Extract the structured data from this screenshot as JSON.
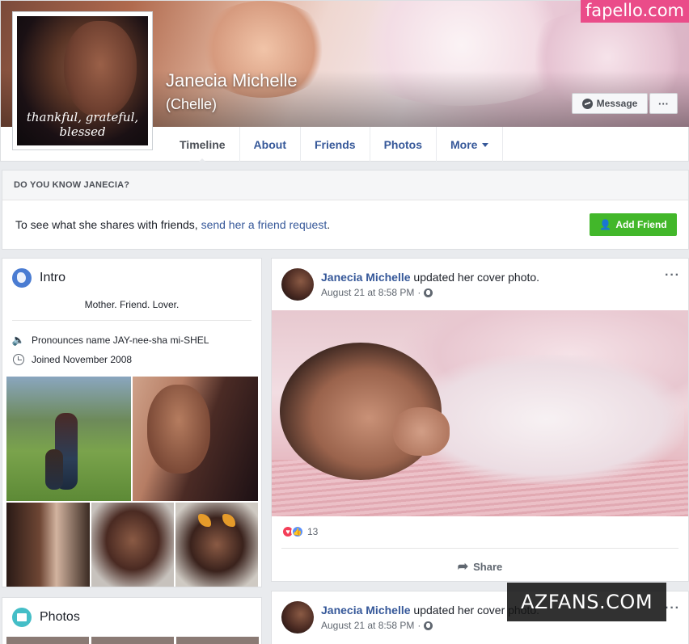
{
  "watermarks": {
    "top": "fapello.com",
    "bottom": "AZFANS.COM"
  },
  "profile": {
    "name": "Janecia Michelle",
    "nickname": "(Chelle)",
    "picture_caption": "thankful, grateful, blessed"
  },
  "actions": {
    "message_label": "Message",
    "more_label": "···"
  },
  "tabs": [
    {
      "label": "Timeline",
      "active": true
    },
    {
      "label": "About"
    },
    {
      "label": "Friends"
    },
    {
      "label": "Photos"
    },
    {
      "label": "More"
    }
  ],
  "know": {
    "heading": "DO YOU KNOW JANECIA?",
    "text_before": "To see what she shares with friends, ",
    "link": "send her a friend request",
    "text_after": ".",
    "add_friend_label": "Add Friend"
  },
  "intro": {
    "title": "Intro",
    "bio": "Mother. Friend. Lover.",
    "pronounce": "Pronounces name JAY-nee-sha mi-SHEL",
    "joined": "Joined November 2008"
  },
  "photos_card": {
    "title": "Photos"
  },
  "posts": [
    {
      "author": "Janecia Michelle",
      "action": " updated her cover photo.",
      "time": "August 21 at 8:58 PM",
      "reaction_count": "13",
      "share_label": "Share",
      "menu": "···"
    },
    {
      "author": "Janecia Michelle",
      "action": " updated her cover photo.",
      "time": "August 21 at 8:58 PM",
      "menu": "···"
    }
  ],
  "colors": {
    "link": "#365899",
    "add_friend": "#42b72a",
    "page_bg": "#e9ebee",
    "love": "#f33e58",
    "like": "#5890ff"
  }
}
